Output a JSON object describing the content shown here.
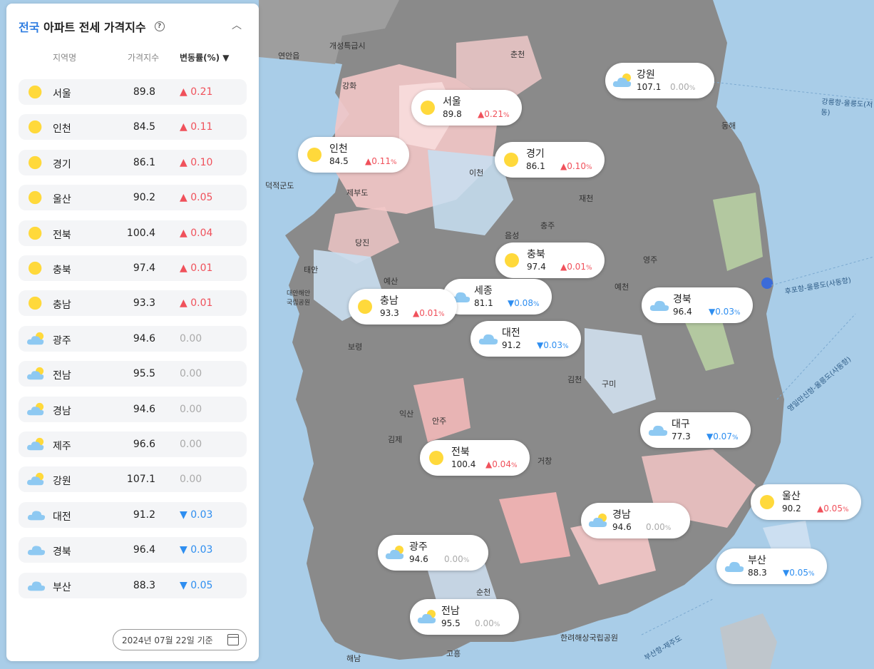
{
  "panel": {
    "title_region": "전국",
    "title_rest": "아파트 전세 가격지수",
    "help_glyph": "?",
    "collapse_glyph": "︿",
    "col_region": "지역명",
    "col_index": "가격지수",
    "col_change": "변동률(%) ▼",
    "date": "2024년 07월 22일 기준"
  },
  "rows": [
    {
      "name": "서울",
      "value": "89.8",
      "change": "▲ 0.21",
      "dir": "up",
      "icon": "sun-icon"
    },
    {
      "name": "인천",
      "value": "84.5",
      "change": "▲ 0.11",
      "dir": "up",
      "icon": "sun-icon"
    },
    {
      "name": "경기",
      "value": "86.1",
      "change": "▲ 0.10",
      "dir": "up",
      "icon": "sun-icon"
    },
    {
      "name": "울산",
      "value": "90.2",
      "change": "▲ 0.05",
      "dir": "up",
      "icon": "sun-icon"
    },
    {
      "name": "전북",
      "value": "100.4",
      "change": "▲ 0.04",
      "dir": "up",
      "icon": "sun-icon"
    },
    {
      "name": "충북",
      "value": "97.4",
      "change": "▲ 0.01",
      "dir": "up",
      "icon": "sun-icon"
    },
    {
      "name": "충남",
      "value": "93.3",
      "change": "▲ 0.01",
      "dir": "up",
      "icon": "sun-icon"
    },
    {
      "name": "광주",
      "value": "94.6",
      "change": "0.00",
      "dir": "zero",
      "icon": "sun-cloud-icon"
    },
    {
      "name": "전남",
      "value": "95.5",
      "change": "0.00",
      "dir": "zero",
      "icon": "sun-cloud-icon"
    },
    {
      "name": "경남",
      "value": "94.6",
      "change": "0.00",
      "dir": "zero",
      "icon": "sun-cloud-icon"
    },
    {
      "name": "제주",
      "value": "96.6",
      "change": "0.00",
      "dir": "zero",
      "icon": "sun-cloud-icon"
    },
    {
      "name": "강원",
      "value": "107.1",
      "change": "0.00",
      "dir": "zero",
      "icon": "sun-cloud-icon"
    },
    {
      "name": "대전",
      "value": "91.2",
      "change": "▼ 0.03",
      "dir": "down",
      "icon": "cloud-icon"
    },
    {
      "name": "경북",
      "value": "96.4",
      "change": "▼ 0.03",
      "dir": "down",
      "icon": "cloud-icon"
    },
    {
      "name": "부산",
      "value": "88.3",
      "change": "▼ 0.05",
      "dir": "down",
      "icon": "cloud-icon"
    }
  ],
  "bubbles": [
    {
      "name": "서울",
      "value": "89.8",
      "change": "▲0.21",
      "dir": "up",
      "icon": "sun-icon"
    },
    {
      "name": "강원",
      "value": "107.1",
      "change": "0.00",
      "dir": "zero",
      "icon": "sun-cloud-icon"
    },
    {
      "name": "인천",
      "value": "84.5",
      "change": "▲0.11",
      "dir": "up",
      "icon": "sun-icon"
    },
    {
      "name": "경기",
      "value": "86.1",
      "change": "▲0.10",
      "dir": "up",
      "icon": "sun-icon"
    },
    {
      "name": "충북",
      "value": "97.4",
      "change": "▲0.01",
      "dir": "up",
      "icon": "sun-icon"
    },
    {
      "name": "세종",
      "value": "81.1",
      "change": "▼0.08",
      "dir": "down",
      "icon": "cloud-icon"
    },
    {
      "name": "충남",
      "value": "93.3",
      "change": "▲0.01",
      "dir": "up",
      "icon": "sun-icon"
    },
    {
      "name": "경북",
      "value": "96.4",
      "change": "▼0.03",
      "dir": "down",
      "icon": "cloud-icon"
    },
    {
      "name": "대전",
      "value": "91.2",
      "change": "▼0.03",
      "dir": "down",
      "icon": "cloud-icon"
    },
    {
      "name": "대구",
      "value": "77.3",
      "change": "▼0.07",
      "dir": "down",
      "icon": "cloud-icon"
    },
    {
      "name": "전북",
      "value": "100.4",
      "change": "▲0.04",
      "dir": "up",
      "icon": "sun-icon"
    },
    {
      "name": "울산",
      "value": "90.2",
      "change": "▲0.05",
      "dir": "up",
      "icon": "sun-icon"
    },
    {
      "name": "경남",
      "value": "94.6",
      "change": "0.00",
      "dir": "zero",
      "icon": "sun-cloud-icon"
    },
    {
      "name": "광주",
      "value": "94.6",
      "change": "0.00",
      "dir": "zero",
      "icon": "sun-cloud-icon"
    },
    {
      "name": "부산",
      "value": "88.3",
      "change": "▼0.05",
      "dir": "down",
      "icon": "cloud-icon"
    },
    {
      "name": "전남",
      "value": "95.5",
      "change": "0.00",
      "dir": "zero",
      "icon": "sun-cloud-icon"
    }
  ],
  "percent_sign": "%",
  "map_labels": [
    "연안읍",
    "개성특급시",
    "춘천",
    "강화",
    "동해",
    "덕적군도",
    "제부도",
    "이천",
    "당진",
    "재천",
    "충주",
    "음성",
    "영주",
    "태안",
    "예산",
    "대안해안국립공원",
    "보령",
    "예천",
    "김천",
    "익산",
    "김제",
    "구미",
    "거창",
    "안주",
    "순천",
    "고흥",
    "해남",
    "한려해상국립공원",
    "강릉항-울릉도(저동)",
    "후포항-울릉도(사동항)",
    "영일만신항-울릉도(사동항)",
    "부산항-제주도"
  ],
  "colors": {
    "sun": "#ffd93b",
    "cloud": "#8ec9f2",
    "up": "#f0515b",
    "down": "#2e8ef0",
    "zero": "#aaaaaa",
    "link": "#2f7de1"
  }
}
